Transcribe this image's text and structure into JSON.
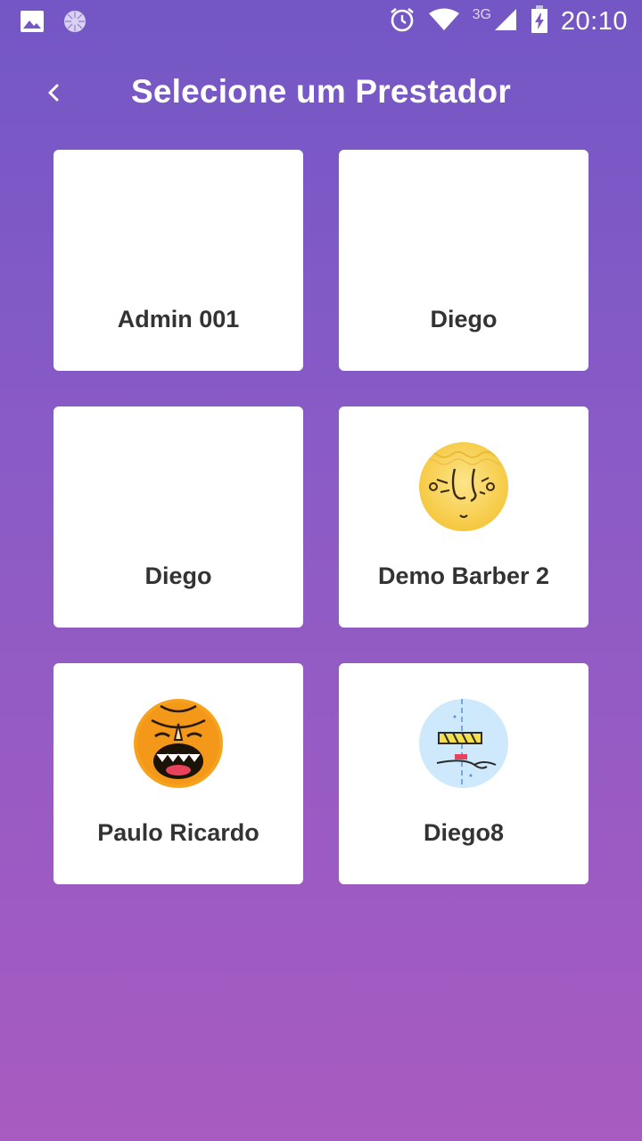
{
  "status_bar": {
    "time": "20:10",
    "network_type": "3G",
    "icons": [
      "image-icon",
      "loading-icon",
      "alarm-icon",
      "wifi-icon",
      "signal-icon",
      "battery-charging-icon"
    ]
  },
  "header": {
    "title": "Selecione um Prestador",
    "back_icon": "chevron-left-icon"
  },
  "providers": [
    {
      "name": "Admin 001",
      "avatar": ""
    },
    {
      "name": "Diego",
      "avatar": ""
    },
    {
      "name": "Diego",
      "avatar": ""
    },
    {
      "name": "Demo Barber 2",
      "avatar": "yellow-face-avatar"
    },
    {
      "name": "Paulo Ricardo",
      "avatar": "orange-mask-avatar"
    },
    {
      "name": "Diego8",
      "avatar": "blue-sketch-avatar"
    }
  ],
  "colors": {
    "gradient_top": "#7357c5",
    "gradient_bottom": "#a85bc0",
    "card_bg": "#ffffff",
    "card_text": "#333333"
  }
}
